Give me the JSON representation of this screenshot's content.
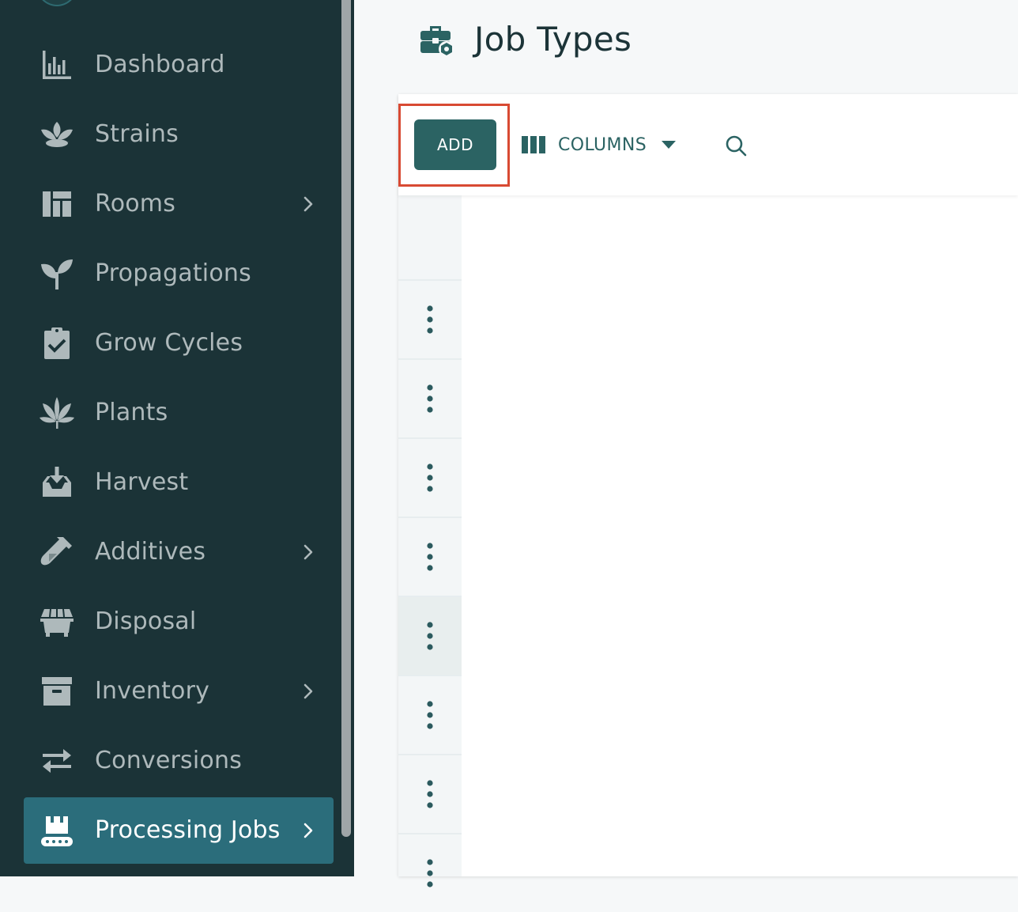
{
  "sidebar": {
    "items": [
      {
        "label": "Dashboard",
        "icon": "bar-chart-icon",
        "has_submenu": false,
        "active": false
      },
      {
        "label": "Strains",
        "icon": "seedling-leaves-icon",
        "has_submenu": false,
        "active": false
      },
      {
        "label": "Rooms",
        "icon": "grid-layout-icon",
        "has_submenu": true,
        "active": false
      },
      {
        "label": "Propagations",
        "icon": "sprout-icon",
        "has_submenu": false,
        "active": false
      },
      {
        "label": "Grow Cycles",
        "icon": "clipboard-check-icon",
        "has_submenu": false,
        "active": false
      },
      {
        "label": "Plants",
        "icon": "cannabis-leaf-icon",
        "has_submenu": false,
        "active": false
      },
      {
        "label": "Harvest",
        "icon": "inbox-download-icon",
        "has_submenu": false,
        "active": false
      },
      {
        "label": "Additives",
        "icon": "test-tube-icon",
        "has_submenu": true,
        "active": false
      },
      {
        "label": "Disposal",
        "icon": "dumpster-icon",
        "has_submenu": false,
        "active": false
      },
      {
        "label": "Inventory",
        "icon": "archive-box-icon",
        "has_submenu": true,
        "active": false
      },
      {
        "label": "Conversions",
        "icon": "exchange-arrows-icon",
        "has_submenu": false,
        "active": false
      },
      {
        "label": "Processing Jobs",
        "icon": "conveyor-belt-icon",
        "has_submenu": true,
        "active": true
      }
    ]
  },
  "header": {
    "title": "Job Types",
    "icon": "briefcase-cog-icon"
  },
  "toolbar": {
    "add_label": "ADD",
    "columns_label": "COLUMNS",
    "columns_icon": "columns-icon",
    "search_icon": "search-icon"
  },
  "table": {
    "row_action_icon": "more-vertical-icon",
    "visible_rows": 8,
    "hovered_row": 4
  },
  "colors": {
    "sidebar_bg": "#1b3337",
    "sidebar_active": "#2b6d7b",
    "accent": "#2b6363",
    "highlight": "#d84a33"
  }
}
